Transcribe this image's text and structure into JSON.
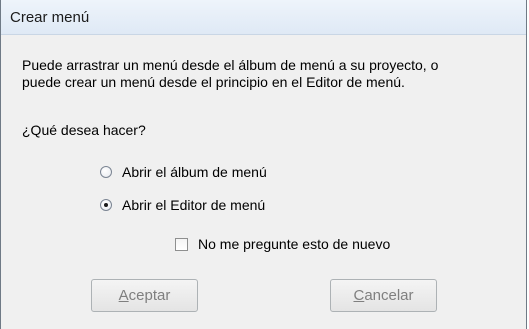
{
  "window": {
    "title": "Crear menú"
  },
  "message": {
    "line1": "Puede arrastrar un menú desde el álbum de menú a su proyecto, o",
    "line2": "puede crear un menú desde el principio en el Editor de menú."
  },
  "question": "¿Qué desea hacer?",
  "options": [
    {
      "label": "Abrir el álbum de menú",
      "selected": false
    },
    {
      "label": "Abrir el Editor de menú",
      "selected": true
    }
  ],
  "dont_ask": {
    "label": "No me pregunte esto de nuevo",
    "checked": false
  },
  "buttons": {
    "ok": {
      "accel": "A",
      "rest": "ceptar",
      "enabled": false
    },
    "cancel": {
      "accel": "C",
      "rest": "ancelar",
      "enabled": false
    }
  }
}
